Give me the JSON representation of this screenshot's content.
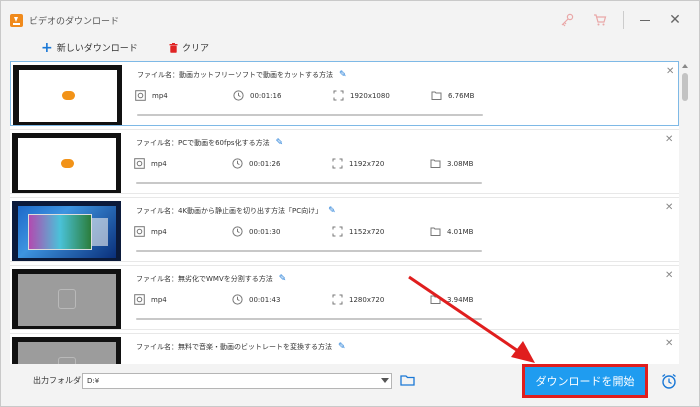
{
  "window": {
    "title": "ビデオのダウンロード"
  },
  "toolbar": {
    "new_download": "新しいダウンロード",
    "clear": "クリア"
  },
  "items": [
    {
      "filename": "ファイル名：動画カットフリーソフトで動画をカットする方法",
      "format": "mp4",
      "duration": "00:01:16",
      "resolution": "1920x1080",
      "size": "6.76MB",
      "thumb": "white"
    },
    {
      "filename": "ファイル名：PCで動画を60fps化する方法",
      "format": "mp4",
      "duration": "00:01:26",
      "resolution": "1192x720",
      "size": "3.08MB",
      "thumb": "white"
    },
    {
      "filename": "ファイル名：4K動画から静止画を切り出す方法「PC向け」",
      "format": "mp4",
      "duration": "00:01:30",
      "resolution": "1152x720",
      "size": "4.01MB",
      "thumb": "screen"
    },
    {
      "filename": "ファイル名：無劣化でWMVを分割する方法",
      "format": "mp4",
      "duration": "00:01:43",
      "resolution": "1280x720",
      "size": "3.94MB",
      "thumb": "gray"
    },
    {
      "filename": "ファイル名：無料で音楽・動画のビットレートを変換する方法",
      "format": "",
      "duration": "",
      "resolution": "",
      "size": "",
      "thumb": "gray"
    }
  ],
  "bottom": {
    "output_label": "出力フォルダ：",
    "output_path": "D:¥",
    "download_button": "ダウンロードを開始"
  },
  "colors": {
    "accent": "#1a78d6",
    "button": "#1f9cf0",
    "highlight": "#e01e1e",
    "app_icon": "#f08a1c"
  }
}
